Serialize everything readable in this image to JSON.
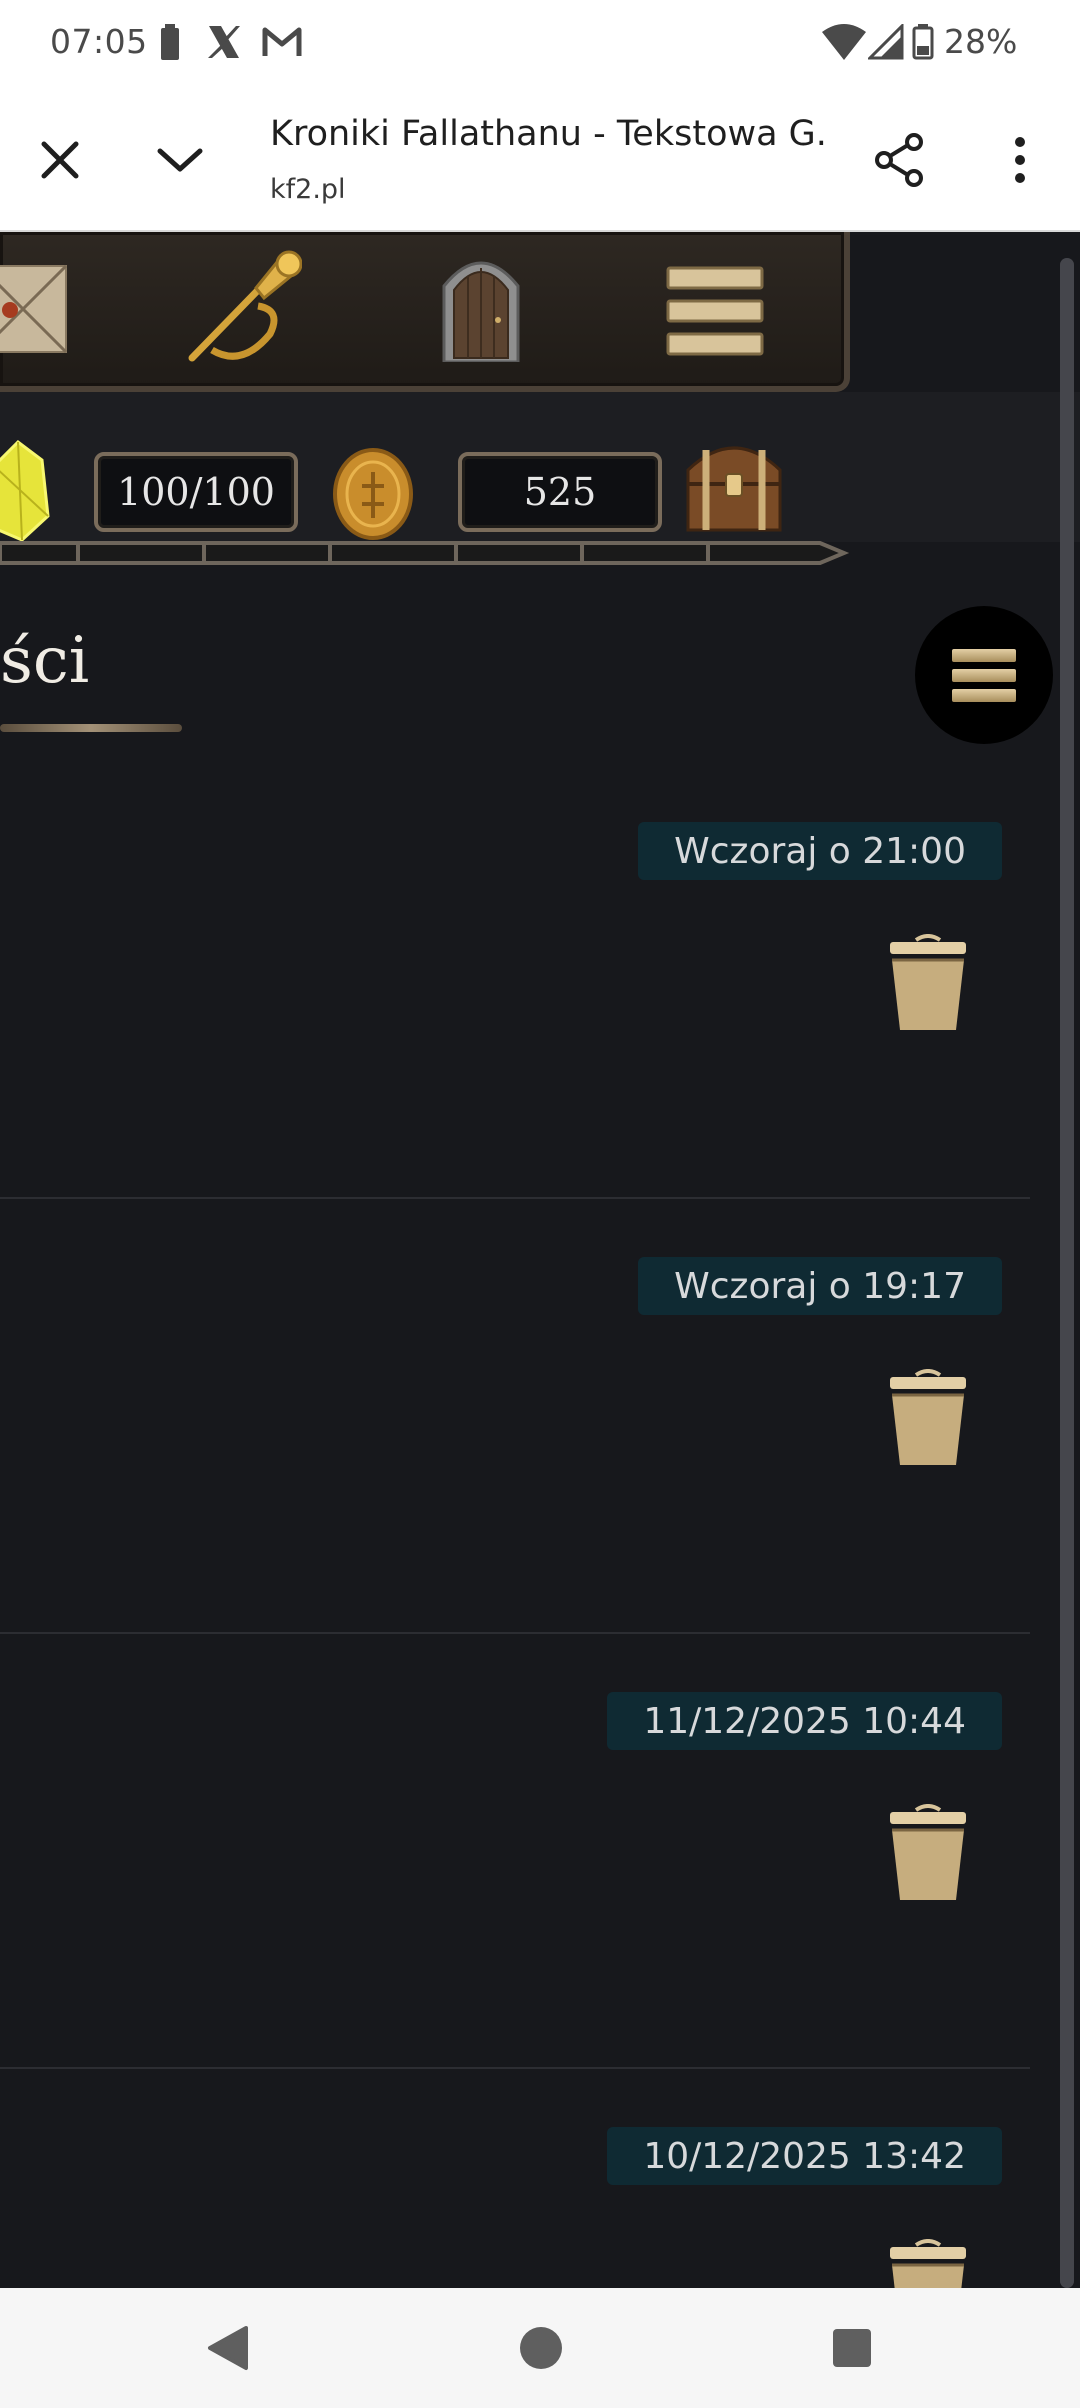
{
  "status_bar": {
    "time": "07:05",
    "battery_percent": "28%",
    "icons": [
      "battery-icon",
      "x-twitter-icon",
      "gmail-icon",
      "wifi-icon",
      "signal-icon",
      "battery-outline-icon"
    ]
  },
  "browser": {
    "page_title": "Kroniki Fallathanu - Tekstowa G...",
    "url": "kf2.pl",
    "icons": [
      "close-icon",
      "chevron-down-icon",
      "share-icon",
      "more-vert-icon"
    ]
  },
  "game_header": {
    "icons": [
      "letter-icon",
      "horn-icon",
      "door-icon",
      "menu-bars-icon"
    ],
    "energy_value": "100/100",
    "gold_value": "525",
    "stat_icons": [
      "crystal-icon",
      "gold-coin-icon",
      "treasure-chest-icon"
    ]
  },
  "main": {
    "heading": "ści",
    "messages": [
      {
        "date": "Wczoraj o 21:00"
      },
      {
        "date": "Wczoraj o 19:17"
      },
      {
        "date": "11/12/2025 10:44"
      },
      {
        "date": "10/12/2025 13:42"
      }
    ]
  },
  "colors": {
    "background": "#17181c",
    "date_badge": "#0f2a33",
    "gold_accent": "#c9b27e"
  },
  "nav_bar": {
    "icons": [
      "back-icon",
      "home-icon",
      "recents-icon"
    ]
  }
}
